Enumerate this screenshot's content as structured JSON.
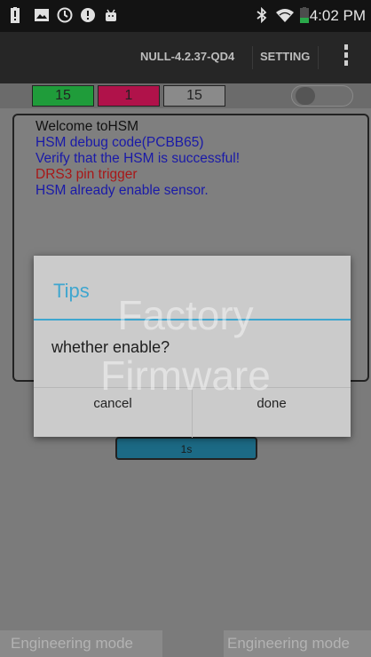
{
  "status_bar": {
    "time": "4:02 PM",
    "icons": [
      "battery-alert-icon",
      "image-icon",
      "clock-icon",
      "alert-icon",
      "android-icon",
      "bluetooth-icon",
      "wifi-icon",
      "battery-icon"
    ]
  },
  "action_bar": {
    "version": "NULL-4.2.37-QD4",
    "setting": "SETTING",
    "overflow_icon": "more-vert-icon"
  },
  "counters": [
    {
      "value": "15",
      "color": "#1f9c3a"
    },
    {
      "value": "1",
      "color": "#b0124a"
    },
    {
      "value": "15",
      "color": "#8a8a8a"
    }
  ],
  "log": [
    {
      "text": "Welcome toHSM",
      "color": "#111111"
    },
    {
      "text": "HSM debug code(PCBB65)",
      "color": "#1a1aa8"
    },
    {
      "text": "Verify that the HSM is successful!",
      "color": "#1a1aa8"
    },
    {
      "text": "DRS3 pin trigger",
      "color": "#a81818"
    },
    {
      "text": "HSM already enable sensor.",
      "color": "#1a1aa8"
    }
  ],
  "interval": "1s",
  "dialog": {
    "title": "Tips",
    "message": "whether enable?",
    "cancel": "cancel",
    "done": "done"
  },
  "watermark": {
    "line1": "Factory",
    "line2": "Firmware"
  },
  "footer": {
    "left": "Engineering mode",
    "right": "Engineering mode"
  },
  "colors": {
    "accent": "#3fa6cf",
    "status_bar": "#131313",
    "action_bar": "#262626"
  }
}
